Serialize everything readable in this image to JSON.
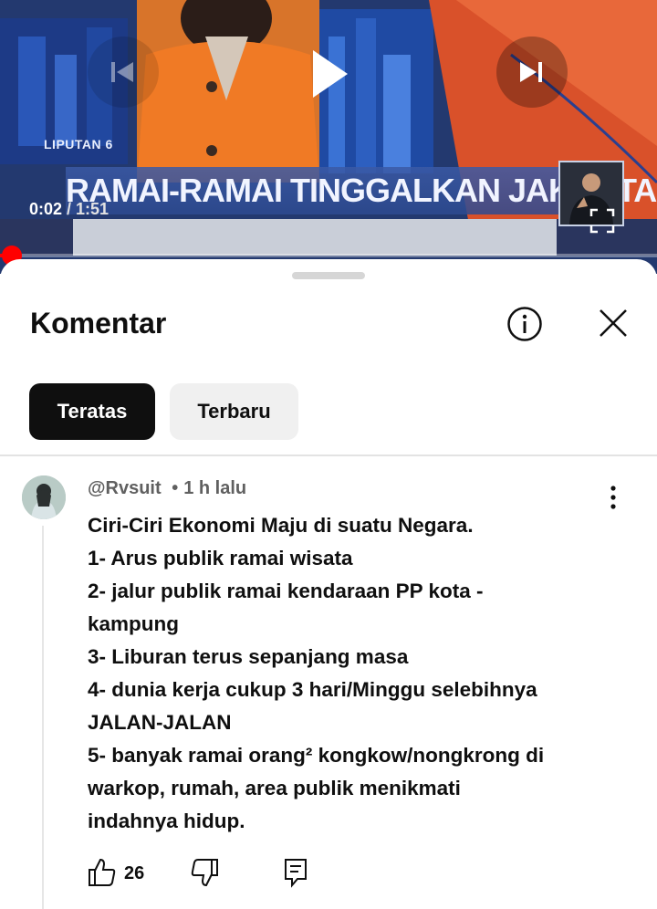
{
  "video": {
    "channel_label": "LIPUTAN 6",
    "headline": "RAMAI-RAMAI TINGGALKAN JAKARTA",
    "current_time": "0:02",
    "duration": " / 1:51",
    "progress_fraction": 0.007,
    "controls": {
      "prev_icon": "skip-previous-icon",
      "play_icon": "play-icon",
      "next_icon": "skip-next-icon",
      "fullscreen_icon": "fullscreen-icon"
    },
    "colors": {
      "progress": "#ff0000"
    }
  },
  "comments_sheet": {
    "title": "Komentar",
    "info_icon": "info-icon",
    "close_icon": "close-icon",
    "tabs": [
      {
        "label": "Teratas",
        "active": true
      },
      {
        "label": "Terbaru",
        "active": false
      }
    ],
    "comment": {
      "author": "@Rvsuit",
      "separator": "•",
      "time": "1 h lalu",
      "lines": [
        "Ciri-Ciri Ekonomi Maju di suatu Negara.",
        "1- Arus publik ramai wisata",
        "2- jalur publik ramai kendaraan PP kota -",
        "kampung",
        "3- Liburan terus sepanjang masa",
        "4- dunia kerja cukup 3 hari/Minggu selebihnya",
        "JALAN-JALAN",
        "5- banyak ramai orang² kongkow/nongkrong di",
        "warkop, rumah, area publik menikmati",
        "indahnya hidup."
      ],
      "likes": "26"
    }
  }
}
